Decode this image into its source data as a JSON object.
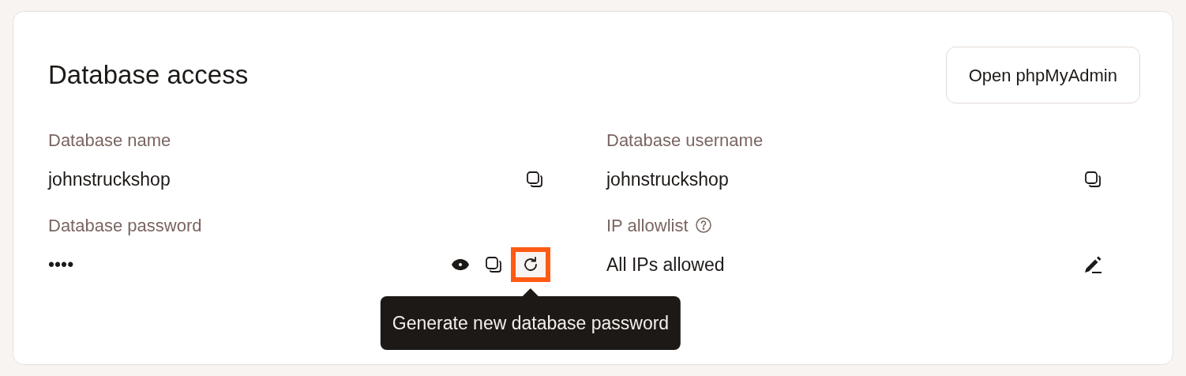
{
  "title": "Database access",
  "header_button": "Open phpMyAdmin",
  "fields": [
    {
      "label": "Database name",
      "value": "johnstruckshop",
      "help": false,
      "actions": [
        {
          "kind": "copy",
          "highlighted": false
        }
      ]
    },
    {
      "label": "Database username",
      "value": "johnstruckshop",
      "help": false,
      "actions": [
        {
          "kind": "copy",
          "highlighted": false
        }
      ]
    },
    {
      "label": "Database password",
      "value": "••••",
      "help": false,
      "actions": [
        {
          "kind": "reveal",
          "highlighted": false
        },
        {
          "kind": "copy",
          "highlighted": false
        },
        {
          "kind": "regenerate",
          "highlighted": true,
          "tooltip": "Generate new database password"
        }
      ]
    },
    {
      "label": "IP allowlist",
      "value": "All IPs allowed",
      "help": true,
      "actions": [
        {
          "kind": "edit",
          "highlighted": false
        }
      ]
    }
  ]
}
